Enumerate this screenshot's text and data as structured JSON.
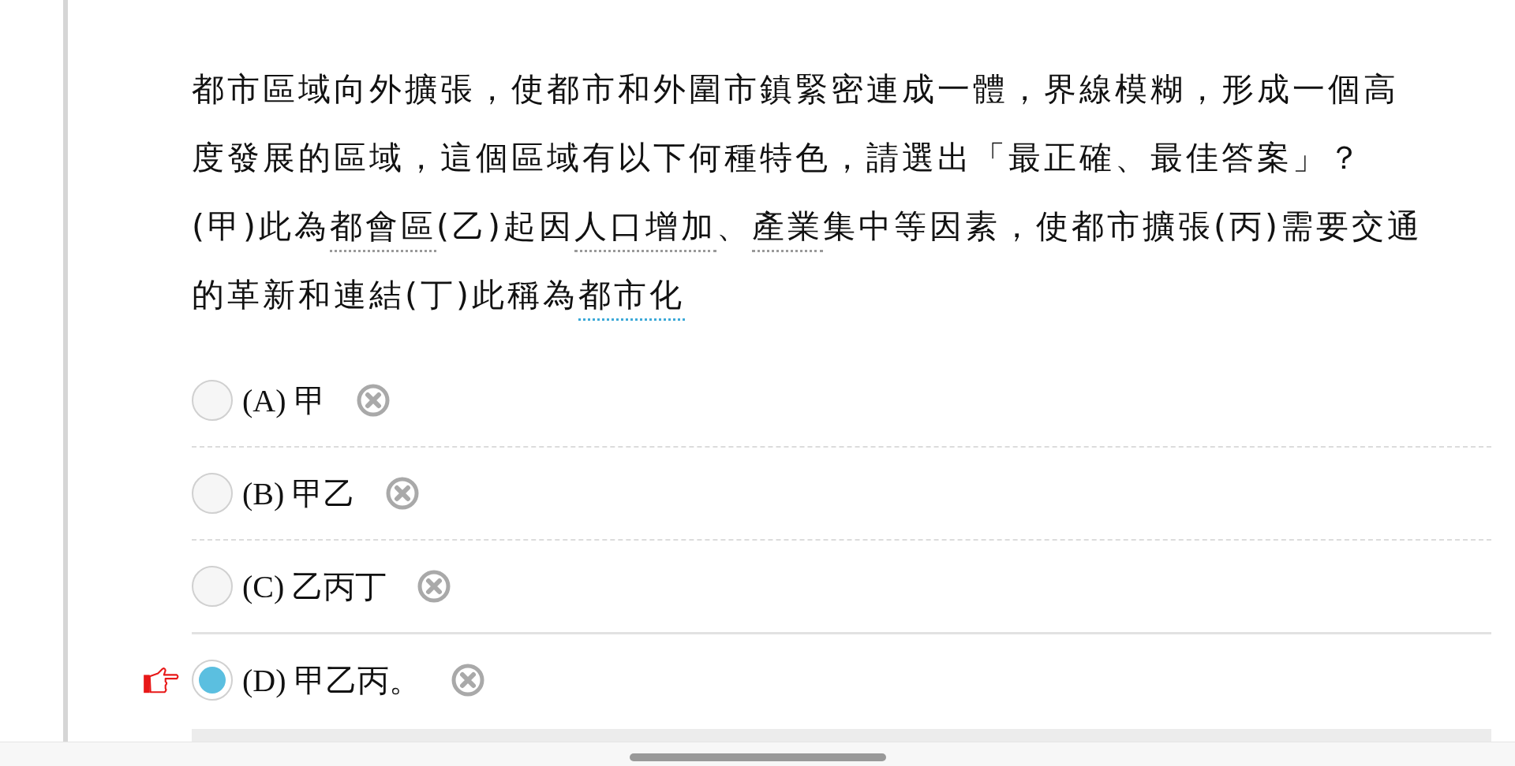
{
  "question": {
    "lines": [
      {
        "segments": [
          {
            "kind": "plain",
            "text": "都市區域向外擴張，使都市和外圍市鎮緊密連成一體，界線模糊，形成一個高"
          }
        ]
      },
      {
        "segments": [
          {
            "kind": "plain",
            "text": "度發展的區域，這個區域有以下何種特色，請選出「最正確、最佳答案」？"
          }
        ]
      },
      {
        "segments": [
          {
            "kind": "plain",
            "text": "(甲)此為"
          },
          {
            "kind": "term",
            "text": "都會區"
          },
          {
            "kind": "plain",
            "text": "(乙)起因"
          },
          {
            "kind": "term",
            "text": "人口增加"
          },
          {
            "kind": "plain",
            "text": "、"
          },
          {
            "kind": "term",
            "text": "產業"
          },
          {
            "kind": "plain",
            "text": "集中等因素，使都市擴張(丙)需要交通"
          }
        ]
      },
      {
        "segments": [
          {
            "kind": "plain",
            "text": "的革新和連結(丁)此稱為"
          },
          {
            "kind": "link",
            "text": "都市化"
          }
        ]
      }
    ]
  },
  "options": [
    {
      "label": "(A) 甲",
      "selected": false
    },
    {
      "label": "(B) 甲乙",
      "selected": false
    },
    {
      "label": "(C) 乙丙丁",
      "selected": false
    },
    {
      "label": "(D) 甲乙丙。",
      "selected": true
    }
  ]
}
